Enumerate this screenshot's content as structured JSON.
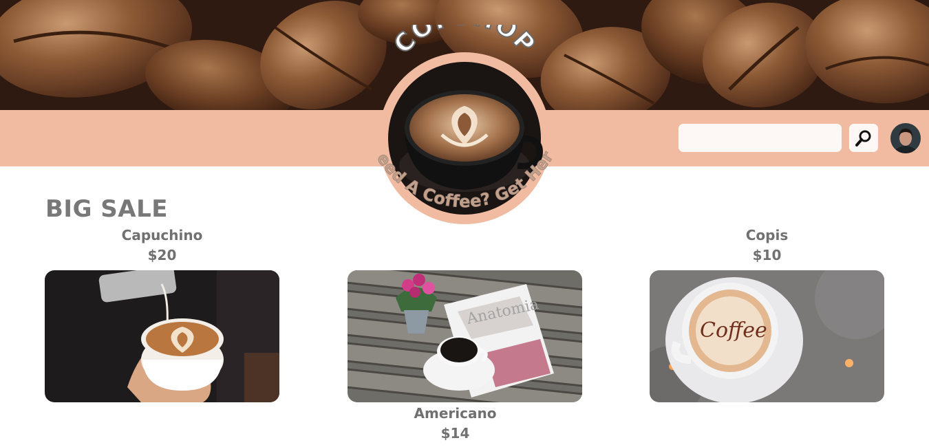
{
  "brand": {
    "name": "COFSHOP",
    "tagline": "Need A Coffee? Get Here"
  },
  "header": {
    "search": {
      "placeholder": "",
      "value": ""
    },
    "search_icon": "magnifier-icon",
    "avatar_icon": "user-avatar"
  },
  "main": {
    "section_title": "BIG SALE",
    "products": [
      {
        "name": "Capuchino",
        "price": "$20",
        "image": "latte-pour-photo"
      },
      {
        "name": "Americano",
        "price": "$14",
        "image": "coffee-magazine-photo"
      },
      {
        "name": "Copis",
        "price": "$10",
        "image": "coffee-art-cup-photo"
      }
    ]
  },
  "colors": {
    "accent": "#f0bba0",
    "text": "#787878"
  }
}
